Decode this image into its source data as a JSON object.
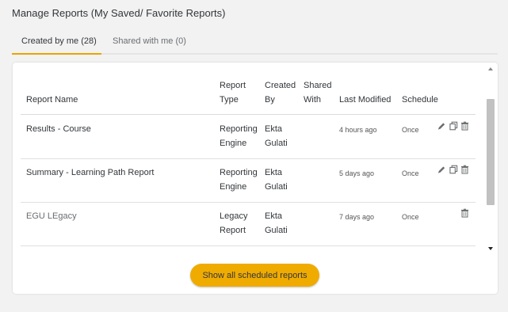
{
  "page": {
    "title": "Manage Reports (My Saved/ Favorite Reports)"
  },
  "tabs": [
    {
      "label": "Created by me (28)",
      "active": true
    },
    {
      "label": "Shared with me (0)",
      "active": false
    }
  ],
  "table": {
    "headers": {
      "report_name": "Report Name",
      "report_type_1": "Report",
      "report_type_2": "Type",
      "created_by_1": "Created",
      "created_by_2": "By",
      "shared_with_1": "Shared",
      "shared_with_2": "With",
      "last_modified": "Last Modified",
      "schedule": "Schedule"
    },
    "rows": [
      {
        "name": "Results - Course",
        "type_1": "Reporting",
        "type_2": "Engine",
        "by_1": "Ekta",
        "by_2": "Gulati",
        "shared": "",
        "modified": "4 hours ago",
        "schedule": "Once"
      },
      {
        "name": "Summary - Learning Path Report",
        "type_1": "Reporting",
        "type_2": "Engine",
        "by_1": "Ekta",
        "by_2": "Gulati",
        "shared": "",
        "modified": "5 days ago",
        "schedule": "Once"
      },
      {
        "name": "EGU LEgacy",
        "type_1": "Legacy",
        "type_2": "Report",
        "by_1": "Ekta",
        "by_2": "Gulati",
        "shared": "",
        "modified": "7 days ago",
        "schedule": "Once"
      }
    ]
  },
  "actions": {
    "edit_icon": "pencil-icon",
    "copy_icon": "copy-icon",
    "delete_icon": "trash-icon"
  },
  "button": {
    "show_all_label": "Show all scheduled reports"
  },
  "colors": {
    "accent": "#f0ab00",
    "tab_underline": "#e9a400",
    "background": "#f2f2f2"
  }
}
